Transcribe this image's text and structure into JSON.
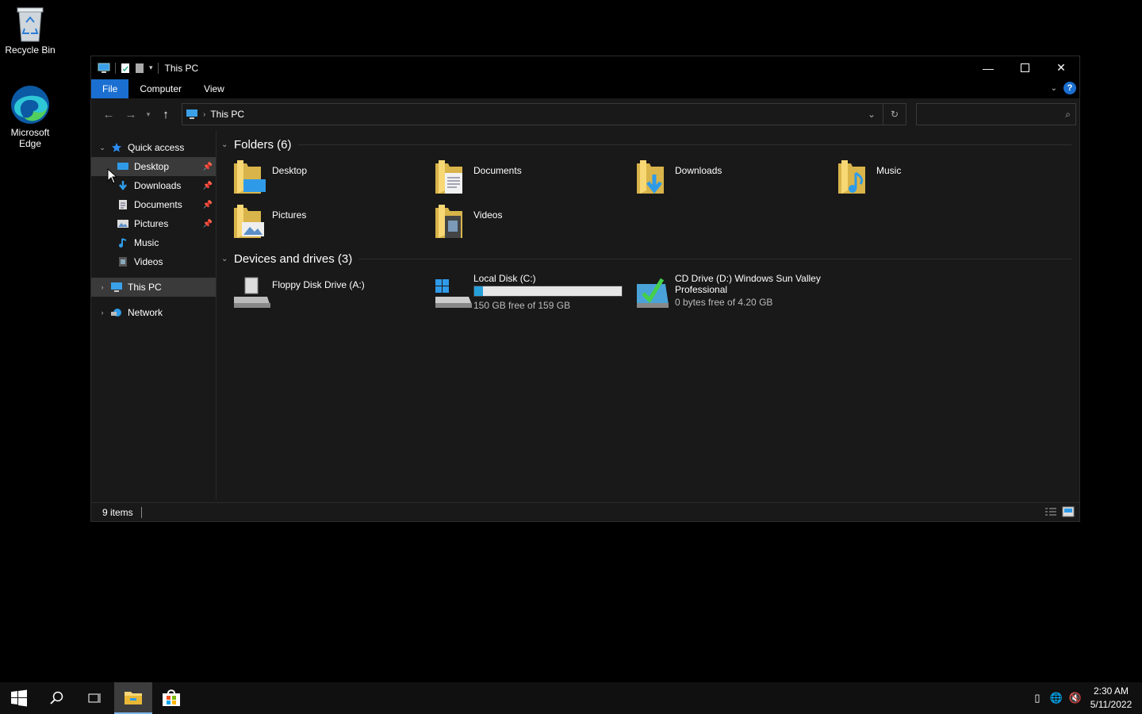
{
  "desktop": {
    "icons": [
      {
        "label": "Recycle Bin"
      },
      {
        "label": "Microsoft Edge"
      }
    ]
  },
  "window": {
    "title": "This PC",
    "ribbon_tabs": [
      "File",
      "Computer",
      "View"
    ],
    "help_label": "?",
    "address": {
      "path": "This PC"
    },
    "search": {
      "placeholder": ""
    },
    "sidebar": {
      "quick_access": "Quick access",
      "quick_items": [
        "Desktop",
        "Downloads",
        "Documents",
        "Pictures",
        "Music",
        "Videos"
      ],
      "this_pc": "This PC",
      "network": "Network"
    },
    "folders": {
      "header": "Folders (6)",
      "items": [
        "Desktop",
        "Documents",
        "Downloads",
        "Music",
        "Pictures",
        "Videos"
      ]
    },
    "drives": {
      "header": "Devices and drives (3)",
      "items": [
        {
          "name": "Floppy Disk Drive (A:)",
          "free": ""
        },
        {
          "name": "Local Disk (C:)",
          "free": "150 GB free of 159 GB",
          "used_fraction": 0.057
        },
        {
          "name": "CD Drive (D:) Windows Sun Valley Professional",
          "free": "0 bytes free of 4.20 GB"
        }
      ]
    },
    "status": {
      "item_count": "9 items"
    }
  },
  "taskbar": {
    "clock_time": "2:30 AM",
    "clock_date": "5/11/2022"
  },
  "colors": {
    "accent": "#1a6fd1",
    "folder_yellow": "#f8d775",
    "drive_fill": "#26a0da"
  }
}
